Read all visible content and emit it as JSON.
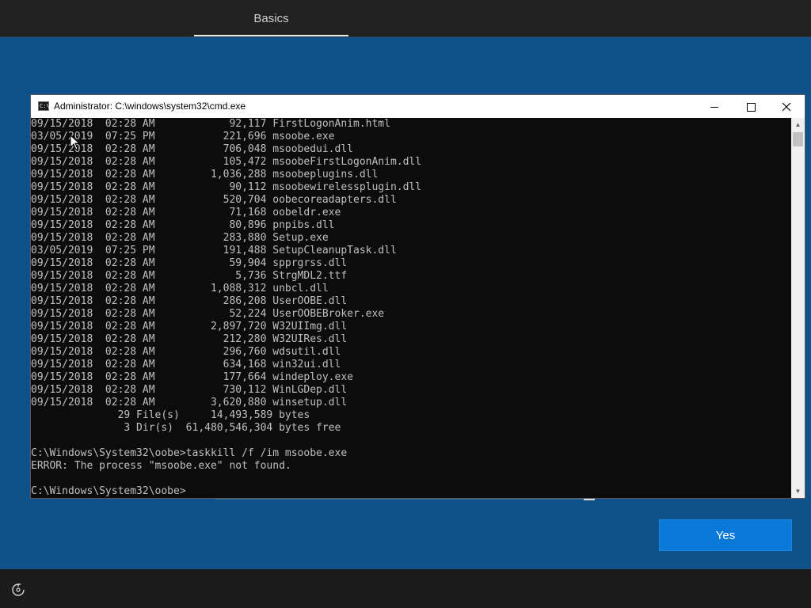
{
  "header": {
    "tab_label": "Basics"
  },
  "cmd": {
    "title": "Administrator: C:\\windows\\system32\\cmd.exe",
    "lines": [
      "09/15/2018  02:28 AM            92,117 FirstLogonAnim.html",
      "03/05/2019  07:25 PM           221,696 msoobe.exe",
      "09/15/2018  02:28 AM           706,048 msoobedui.dll",
      "09/15/2018  02:28 AM           105,472 msoobeFirstLogonAnim.dll",
      "09/15/2018  02:28 AM         1,036,288 msoobeplugins.dll",
      "09/15/2018  02:28 AM            90,112 msoobewirelessplugin.dll",
      "09/15/2018  02:28 AM           520,704 oobecoreadapters.dll",
      "09/15/2018  02:28 AM            71,168 oobeldr.exe",
      "09/15/2018  02:28 AM            80,896 pnpibs.dll",
      "09/15/2018  02:28 AM           283,880 Setup.exe",
      "03/05/2019  07:25 PM           191,488 SetupCleanupTask.dll",
      "09/15/2018  02:28 AM            59,904 spprgrss.dll",
      "09/15/2018  02:28 AM             5,736 StrgMDL2.ttf",
      "09/15/2018  02:28 AM         1,088,312 unbcl.dll",
      "09/15/2018  02:28 AM           286,208 UserOOBE.dll",
      "09/15/2018  02:28 AM            52,224 UserOOBEBroker.exe",
      "09/15/2018  02:28 AM         2,897,720 W32UIImg.dll",
      "09/15/2018  02:28 AM           212,280 W32UIRes.dll",
      "09/15/2018  02:28 AM           296,760 wdsutil.dll",
      "09/15/2018  02:28 AM           634,168 win32ui.dll",
      "09/15/2018  02:28 AM           177,664 windeploy.exe",
      "09/15/2018  02:28 AM           730,112 WinLGDep.dll",
      "09/15/2018  02:28 AM         3,620,880 winsetup.dll",
      "              29 File(s)     14,493,589 bytes",
      "               3 Dir(s)  61,480,546,304 bytes free",
      "",
      "C:\\Windows\\System32\\oobe>taskkill /f /im msoobe.exe",
      "ERROR: The process \"msoobe.exe\" not found.",
      "",
      "C:\\Windows\\System32\\oobe>"
    ]
  },
  "buttons": {
    "yes_label": "Yes"
  },
  "icons": {
    "cmd_icon": "cmd-icon",
    "minimize": "minimize-icon",
    "maximize": "maximize-icon",
    "close": "close-icon",
    "accessibility": "accessibility-icon",
    "cursor": "mouse-cursor-icon"
  },
  "colors": {
    "background": "#0f5289",
    "accent_button": "#0a78d7",
    "console_bg": "#0c0c0c",
    "console_text": "#c0c0c0"
  }
}
